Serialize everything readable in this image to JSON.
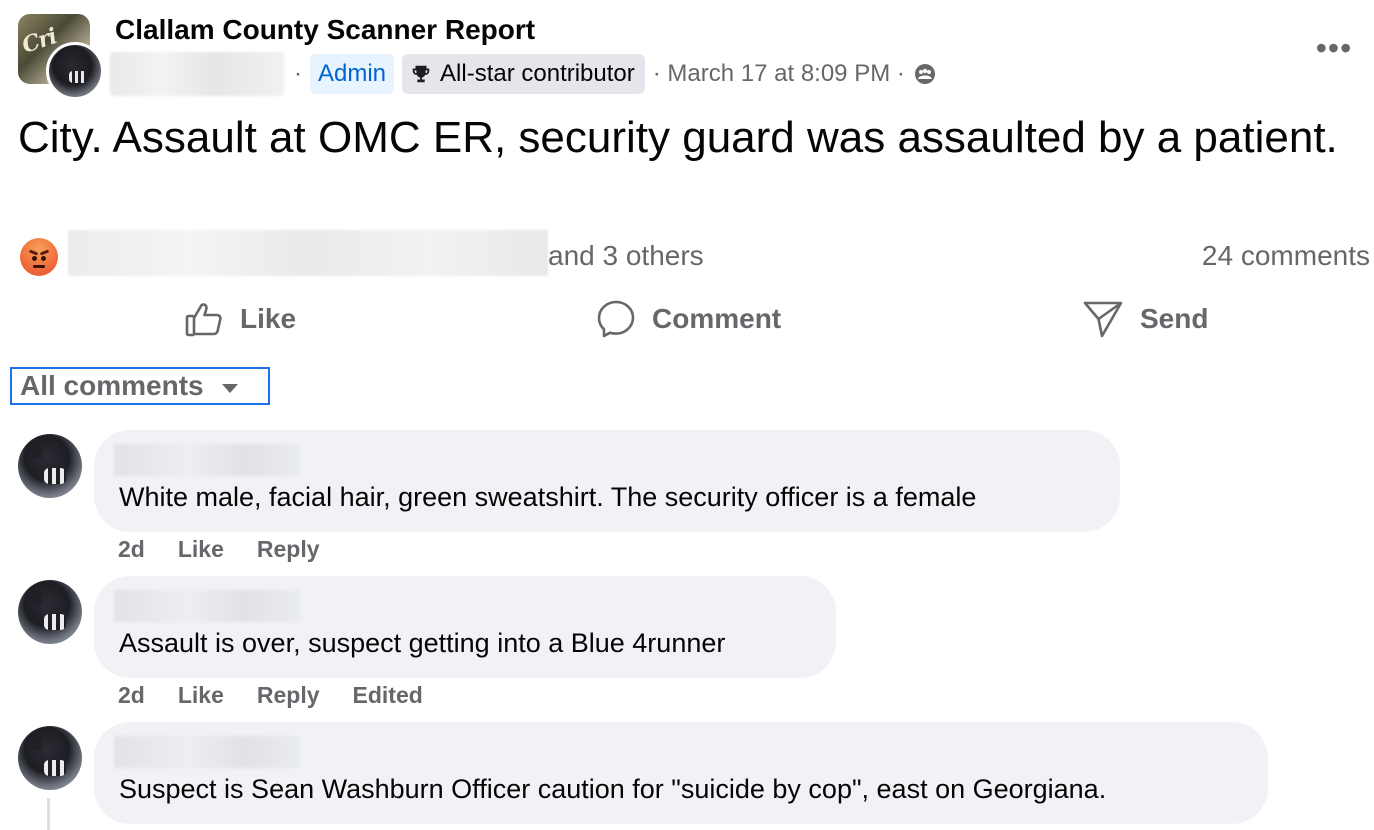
{
  "post": {
    "group_name": "Clallam County Scanner Report",
    "separator": "·",
    "badge_admin": "Admin",
    "badge_allstar": "All-star contributor",
    "timestamp": "· March 17 at 8:09 PM ·",
    "audience_icon": "group-audience-icon",
    "more_icon": "•••",
    "text": "City. Assault at OMC ER, security guard was assaulted by a patient."
  },
  "reactions": {
    "icon": "angry-reaction-icon",
    "others_text": "and 3 others",
    "comment_count": "24 comments"
  },
  "actions": {
    "like": "Like",
    "comment": "Comment",
    "send": "Send"
  },
  "sort": {
    "label": "All comments"
  },
  "comments": [
    {
      "text": "White male, facial hair, green sweatshirt. The security officer is a female",
      "time": "2d",
      "like": "Like",
      "reply": "Reply"
    },
    {
      "text": "Assault is over, suspect getting into a Blue 4runner",
      "time": "2d",
      "like": "Like",
      "reply": "Reply",
      "edited": "Edited"
    },
    {
      "text": "Suspect is Sean Washburn Officer caution for \"suicide by cop\", east on Georgiana."
    }
  ],
  "colors": {
    "accent_blue": "#0064d1",
    "secondary_text": "#65676b",
    "bubble_bg": "#f0f2f5",
    "focus_outline": "#1a73e8"
  }
}
